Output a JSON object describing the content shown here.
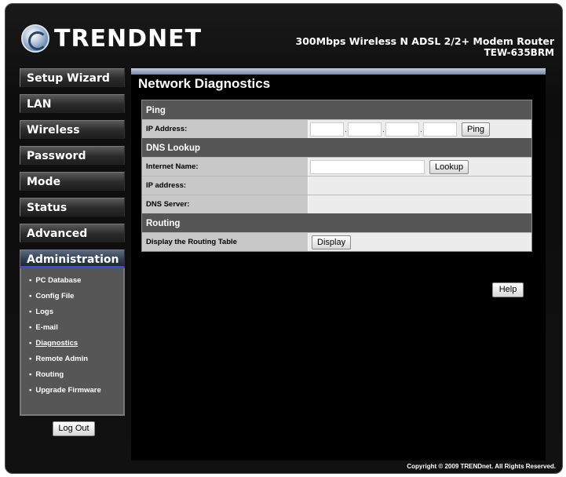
{
  "brand": {
    "name": "TRENDNET"
  },
  "product": {
    "line1": "300Mbps Wireless N ADSL 2/2+ Modem Router",
    "line2": "TEW-635BRM"
  },
  "nav": [
    {
      "label": "Setup Wizard"
    },
    {
      "label": "LAN"
    },
    {
      "label": "Wireless"
    },
    {
      "label": "Password"
    },
    {
      "label": "Mode"
    },
    {
      "label": "Status"
    },
    {
      "label": "Advanced"
    },
    {
      "label": "Administration",
      "active": true
    }
  ],
  "submenu": {
    "bullet": "•",
    "items": [
      {
        "label": "PC Database"
      },
      {
        "label": "Config File"
      },
      {
        "label": "Logs"
      },
      {
        "label": "E-mail"
      },
      {
        "label": "Diagnostics",
        "current": true
      },
      {
        "label": "Remote Admin"
      },
      {
        "label": "Routing"
      },
      {
        "label": "Upgrade Firmware"
      }
    ]
  },
  "logout_label": "Log Out",
  "page_title": "Network Diagnostics",
  "ping": {
    "header": "Ping",
    "ip_label": "IP Address:",
    "ip_octets": [
      "",
      "",
      "",
      ""
    ],
    "ip_separator": ".",
    "button": "Ping"
  },
  "dns": {
    "header": "DNS Lookup",
    "name_label": "Internet Name:",
    "name_value": "",
    "lookup_button": "Lookup",
    "ip_label": "IP address:",
    "ip_value": "",
    "server_label": "DNS Server:",
    "server_value": ""
  },
  "routing": {
    "header": "Routing",
    "label": "Display the Routing Table",
    "button": "Display"
  },
  "help_label": "Help",
  "footer": "Copyright © 2009 TRENDnet. All Rights Reserved.",
  "colors": {
    "accent": "#3355cc",
    "section_bg": "#565656",
    "frame_bg": "#111111"
  }
}
